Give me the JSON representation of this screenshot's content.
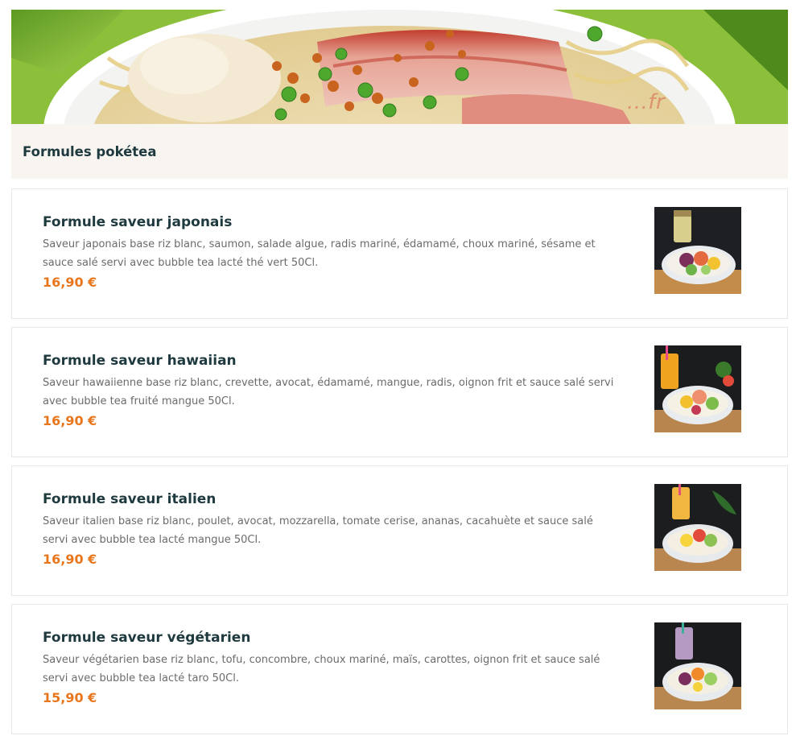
{
  "category": {
    "title": "Formules pokétea",
    "hero_watermark": "...fr"
  },
  "items": [
    {
      "title": "Formule saveur japonais",
      "description": "Saveur japonais base riz blanc, saumon, salade algue, radis mariné, édamamé, choux mariné, sésame et sauce salé servi avec bubble tea lacté thé vert 50Cl.",
      "price": "16,90 €"
    },
    {
      "title": "Formule saveur hawaiian",
      "description": "Saveur hawaiienne base riz blanc, crevette, avocat, édamamé, mangue, radis, oignon frit et sauce salé servi avec bubble tea fruité mangue 50Cl.",
      "price": "16,90 €"
    },
    {
      "title": "Formule saveur italien",
      "description": "Saveur italien base riz blanc, poulet, avocat, mozzarella, tomate cerise, ananas, cacahuète et sauce salé servi avec bubble tea lacté mangue 50Cl.",
      "price": "16,90 €"
    },
    {
      "title": "Formule saveur végétarien",
      "description": "Saveur végétarien base riz blanc, tofu, concombre, choux mariné, maïs, carottes, oignon frit et sauce salé servi avec bubble tea lacté taro 50Cl.",
      "price": "15,90 €"
    }
  ],
  "colors": {
    "title": "#1e3a3f",
    "description": "#6b6b6b",
    "price": "#e8761c",
    "category_bar": "#f8f5f1",
    "card_border": "#e7e7e7"
  }
}
